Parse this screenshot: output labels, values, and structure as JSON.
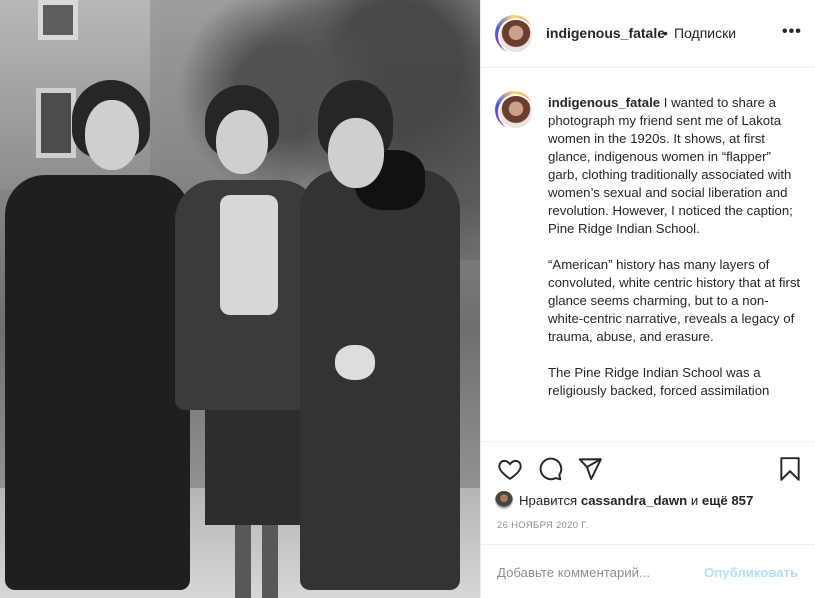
{
  "post": {
    "username": "indigenous_fatale",
    "separator": "•",
    "follow_label": "Подписки",
    "more_label": "•••"
  },
  "caption": {
    "username": "indigenous_fatale",
    "paragraphs": [
      " I wanted to share a photograph my friend sent me of Lakota women in the 1920s. It shows, at first glance, indigenous women in “flapper” garb, clothing traditionally associated with women’s sexual and social liberation and revolution. However, I noticed the caption; Pine Ridge Indian School.",
      "“American” history has many layers of convoluted, white centric history that at first glance seems charming, but to a non-white-centric narrative, reveals a legacy of trauma, abuse, and erasure.",
      "The Pine Ridge Indian School was a religiously backed, forced assimilation"
    ]
  },
  "actions": {
    "icons": [
      "heart-icon",
      "comment-icon",
      "share-icon",
      "bookmark-icon"
    ]
  },
  "likes": {
    "prefix": "Нравится",
    "user": "cassandra_dawn",
    "middle": "и",
    "more": "ещё 857"
  },
  "date": "26 НОЯБРЯ 2020 Г.",
  "comment": {
    "placeholder": "Добавьте комментарий...",
    "publish_label": "Опубликовать"
  },
  "colors": {
    "text": "#262626",
    "muted": "#8e8e8e",
    "publish_disabled": "#b2dffc",
    "border": "#efefef"
  }
}
